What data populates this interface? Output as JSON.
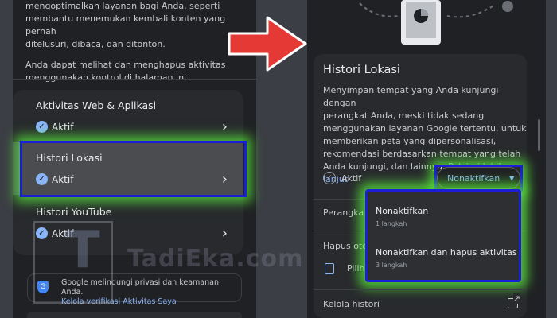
{
  "left": {
    "intro_p1_l1": "mengoptimalkan layanan bagi Anda, seperti",
    "intro_p1_l2": "membantu menemukan kembali konten yang pernah",
    "intro_p1_l3": "ditelusuri, dibaca, dan ditonton.",
    "intro_p2_l1": "Anda dapat melihat dan menghapus aktivitas",
    "intro_p2_l2": "menggunakan kontrol di halaman ini.",
    "items": [
      {
        "title": "Aktivitas Web & Aplikasi",
        "status": "Aktif"
      },
      {
        "title": "Histori Lokasi",
        "status": "Aktif"
      },
      {
        "title": "Histori YouTube",
        "status": "Aktif"
      }
    ],
    "privacy_text": "Google melindungi privasi dan keamanan Anda.",
    "privacy_link": "Kelola verifikasi Aktivitas Saya"
  },
  "watermark": "TadiEka.com",
  "right": {
    "title": "Histori Lokasi",
    "desc_l1": "Menyimpan tempat yang Anda kunjungi dengan",
    "desc_l2": "perangkat Anda, meski tidak sedang",
    "desc_l3": "menggunakan layanan Google tertentu, untuk",
    "desc_l4": "memberikan peta yang dipersonalisasi,",
    "desc_l5": "rekomendasi berdasarkan tempat yang telah",
    "desc_l6": "Anda kunjungi, dan lainnya.",
    "learn_more": "Pelajari lebih lanjut",
    "status": "Aktif",
    "dropdown_label": "Nonaktifkan",
    "partial_device": "Perangka",
    "partial_auto_delete": "Hapus oto",
    "partial_choose": "Pilih",
    "menu": [
      {
        "title": "Nonaktifkan",
        "sub": "1 langkah"
      },
      {
        "title": "Nonaktifkan dan hapus aktivitas",
        "sub": "3 langkah"
      }
    ],
    "manage_history": "Kelola histori"
  },
  "colors": {
    "highlight_border": "#1a1ed8",
    "highlight_glow": "#5af03c",
    "arrow": "#e53935",
    "link": "#8ab4f8"
  }
}
